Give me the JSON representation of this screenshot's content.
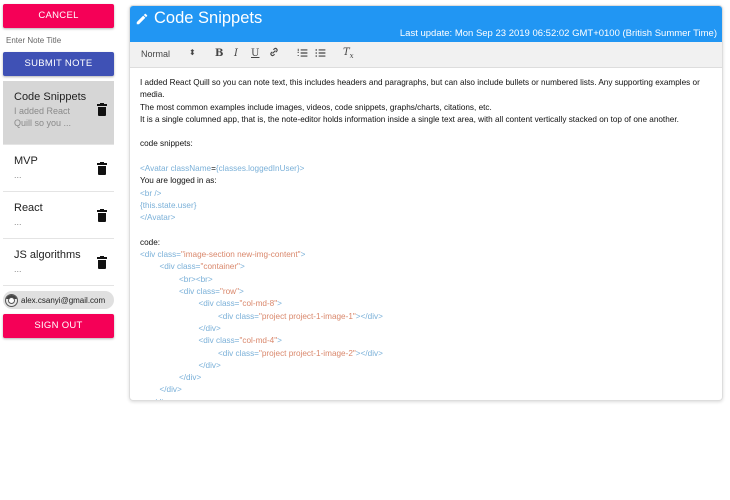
{
  "sidebar": {
    "cancel_label": "CANCEL",
    "title_placeholder": "Enter Note Title",
    "submit_label": "SUBMIT NOTE",
    "notes": [
      {
        "title": "Code Snippets",
        "preview": "I added React Quill so you ..."
      },
      {
        "title": "MVP",
        "preview": "..."
      },
      {
        "title": "React",
        "preview": "..."
      },
      {
        "title": "JS algorithms",
        "preview": "..."
      }
    ],
    "user_email": "alex.csanyi@gmail.com",
    "signout_label": "SIGN OUT"
  },
  "header": {
    "title": "Code Snippets",
    "last_update": "Last update: Mon Sep 23 2019 06:52:02 GMT+0100 (British Summer Time)"
  },
  "toolbar": {
    "format": "Normal",
    "bold": "B",
    "italic": "I",
    "underline": "U",
    "clean": "T"
  },
  "editor": {
    "p1": "I added React Quill so you can note text, this includes headers and paragraphs, but can also include bullets or numbered lists. Any supporting examples or media.",
    "p2": "The most common examples include images, videos, code snippets, graphs/charts, citations, etc.",
    "p3": "It is a single columned app, that is, the note-editor holds information inside a single text area, with all content vertically stacked on top of one another.",
    "p4": "code snippets:",
    "avatar_open_tag": "<Avatar",
    "avatar_attr": "className",
    "avatar_val": "{classes.loggedInUser}",
    "avatar_close_bracket": ">",
    "logged_in": "You are logged in as:",
    "br": "<br />",
    "state_user": "{this.state.user}",
    "avatar_close": "</Avatar>",
    "code_label": "code:",
    "lines": [
      {
        "indent": 0,
        "tag": "<div",
        "attr": " class=",
        "str": "\"image-section new-img-content\"",
        "end": ">"
      },
      {
        "indent": 1,
        "tag": "<div",
        "attr": " class=",
        "str": "\"container\"",
        "end": ">"
      },
      {
        "indent": 2,
        "tag": "<br><br>",
        "attr": "",
        "str": "",
        "end": ""
      },
      {
        "indent": 2,
        "tag": "<div",
        "attr": " class=",
        "str": "\"row\"",
        "end": ">"
      },
      {
        "indent": 3,
        "tag": "<div",
        "attr": " class=",
        "str": "\"col-md-8\"",
        "end": ">"
      },
      {
        "indent": 4,
        "tag": "<div",
        "attr": " class=",
        "str": "\"project project-1-image-1\"",
        "end": "></div>"
      },
      {
        "indent": 3,
        "tag": "</div>",
        "attr": "",
        "str": "",
        "end": ""
      },
      {
        "indent": 3,
        "tag": "<div",
        "attr": " class=",
        "str": "\"col-md-4\"",
        "end": ">"
      },
      {
        "indent": 4,
        "tag": "<div",
        "attr": " class=",
        "str": "\"project project-1-image-2\"",
        "end": "></div>"
      },
      {
        "indent": 3,
        "tag": "</div>",
        "attr": "",
        "str": "",
        "end": ""
      },
      {
        "indent": 2,
        "tag": "</div>",
        "attr": "",
        "str": "",
        "end": ""
      },
      {
        "indent": 1,
        "tag": "</div>",
        "attr": "",
        "str": "",
        "end": ""
      },
      {
        "indent": 0.5,
        "tag": "</div>",
        "attr": "",
        "str": "",
        "end": ""
      }
    ]
  },
  "colors": {
    "primary": "#2196f3",
    "secondary": "#f50057",
    "submit": "#3f51b5",
    "code_tag": "#7ab0d8",
    "code_string": "#d9876b"
  }
}
